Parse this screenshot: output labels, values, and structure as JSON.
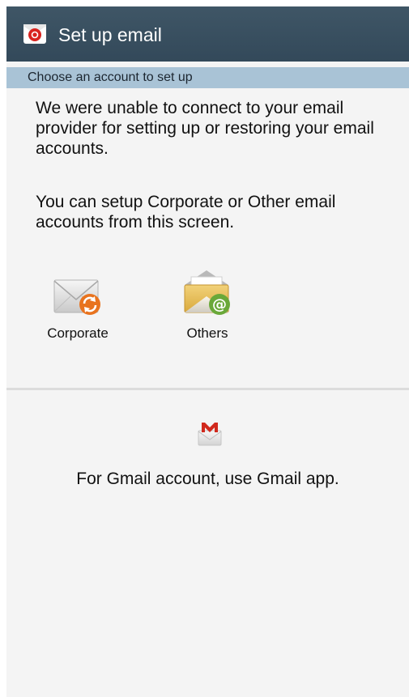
{
  "header": {
    "title": "Set up email",
    "icon": "email-app-icon"
  },
  "subheader": {
    "label": "Choose an account to set up"
  },
  "messages": {
    "unable": "We were unable to connect to your email provider for setting up or restoring your email accounts.",
    "setup": "You can setup Corporate or Other email accounts from this screen."
  },
  "options": [
    {
      "label": "Corporate",
      "icon": "corporate-email-icon"
    },
    {
      "label": "Others",
      "icon": "other-email-icon"
    }
  ],
  "gmail": {
    "icon": "gmail-icon",
    "text": "For Gmail account, use Gmail app."
  },
  "colors": {
    "action_bar": "#3a5060",
    "subheader": "#a9c3d6",
    "background": "#f4f4f4",
    "accent_orange": "#e8731e",
    "accent_green": "#6aa839",
    "gmail_red": "#d1291d"
  }
}
